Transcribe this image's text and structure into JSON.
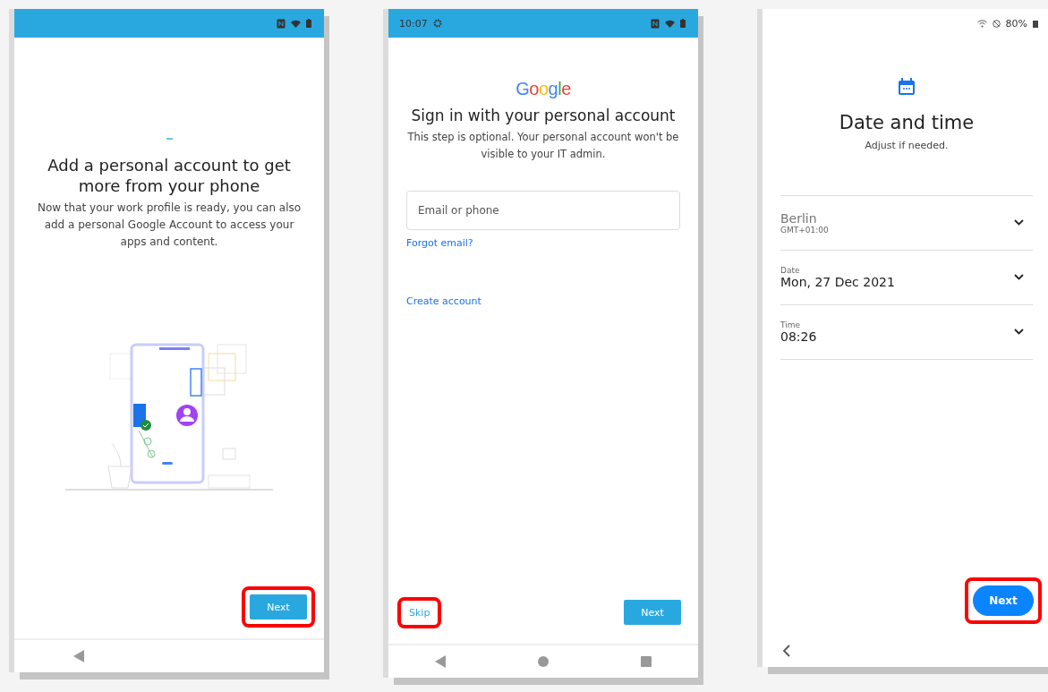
{
  "screens": [
    {
      "kind": "intro",
      "status_bar": {
        "kind": "blue"
      },
      "title": "Add a personal account to get more from your phone",
      "body": "Now that your work profile is ready, you can also add a personal Google Account to access your apps and content.",
      "actions": [
        {
          "label": "Next",
          "kind": "filled",
          "highlighted": true
        }
      ],
      "nav_bar": {
        "kind": "back_only"
      }
    },
    {
      "kind": "sign_in",
      "status_bar": {
        "kind": "blue",
        "time": "10:07"
      },
      "logo": "Google",
      "title": "Sign in with your personal account",
      "body": "This step is optional. Your personal account won't be visible to your IT admin.",
      "field": {
        "placeholder": "Email or phone"
      },
      "links": [
        "Forgot email?",
        "Create account"
      ],
      "actions": [
        {
          "label": "Skip",
          "kind": "text",
          "highlighted": true
        },
        {
          "label": "Next",
          "kind": "filled",
          "highlighted": false
        }
      ],
      "nav_bar": {
        "kind": "three_button"
      }
    },
    {
      "kind": "date_time",
      "status_bar": {
        "kind": "white",
        "battery": "80%"
      },
      "title": "Date and time",
      "body": "Adjust if needed.",
      "rows": [
        {
          "kind": "zone",
          "value": "Berlin",
          "detail": "GMT+01:00"
        },
        {
          "kind": "labeled",
          "label": "Date",
          "value": "Mon, 27 Dec 2021"
        },
        {
          "kind": "labeled",
          "label": "Time",
          "value": "08:26"
        }
      ],
      "actions": [
        {
          "label": "Next",
          "kind": "pill",
          "highlighted": true
        }
      ],
      "nav_bar": {
        "kind": "chevron"
      }
    }
  ]
}
